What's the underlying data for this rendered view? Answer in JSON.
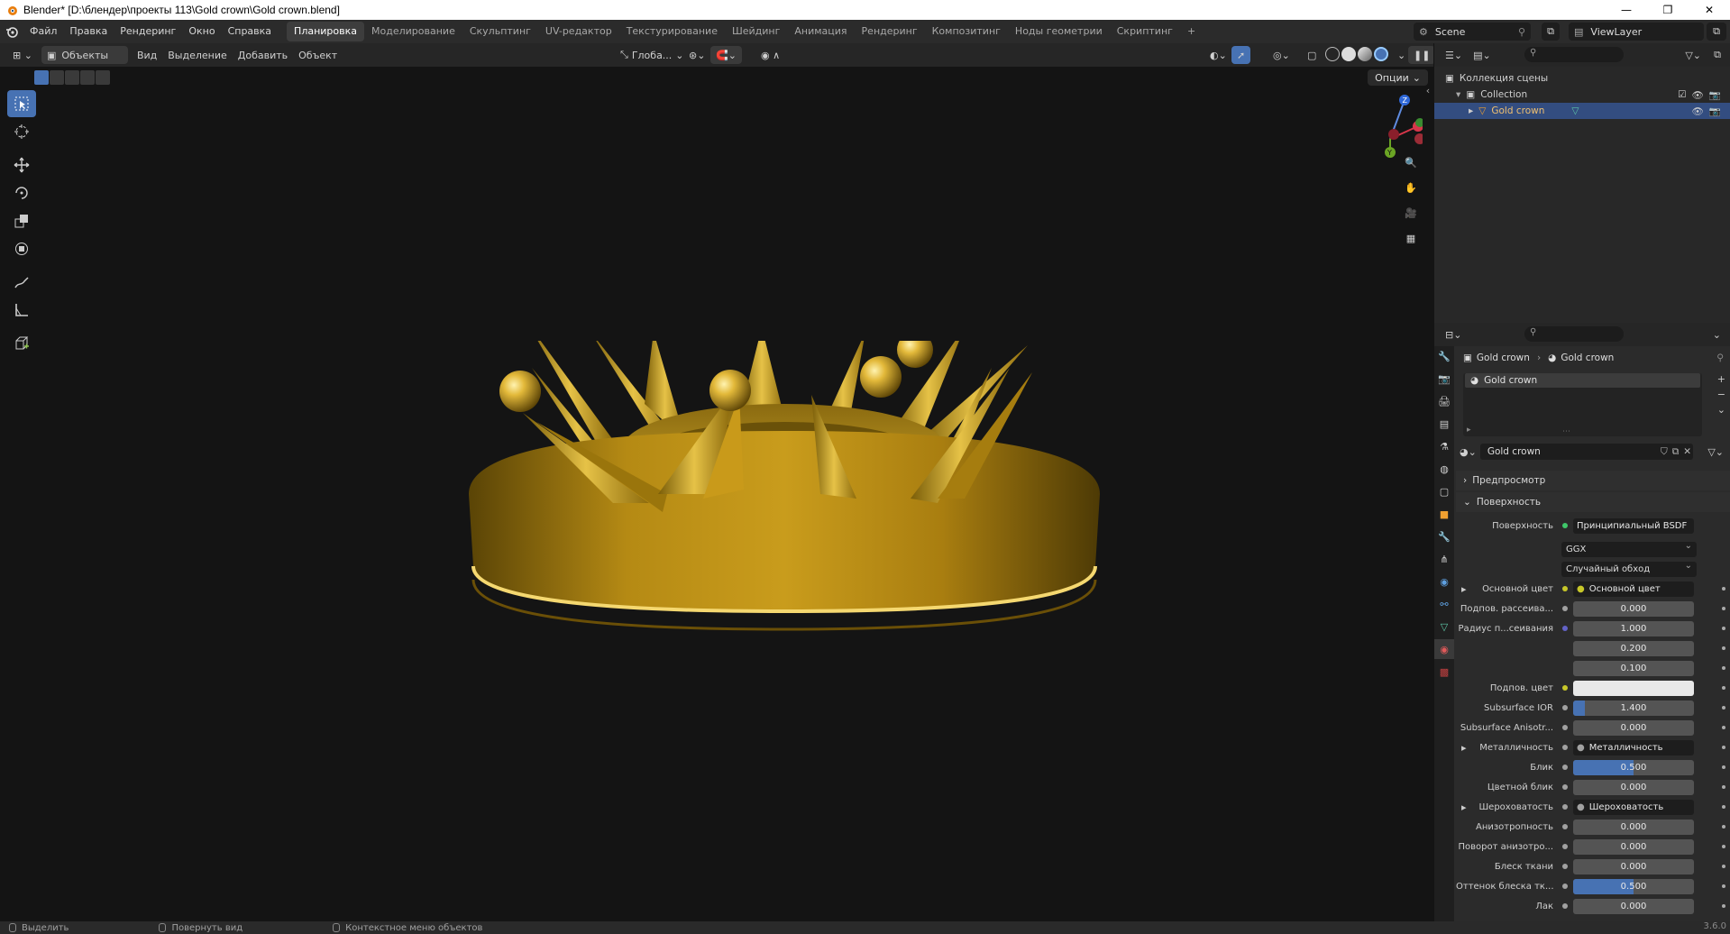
{
  "window": {
    "title": "Blender* [D:\\блендер\\проекты 113\\Gold crown\\Gold crown.blend]",
    "controls": [
      "—",
      "❐",
      "✕"
    ]
  },
  "menu": [
    "Файл",
    "Правка",
    "Рендеринг",
    "Окно",
    "Справка"
  ],
  "workspaces": [
    {
      "label": "Планировка",
      "active": true
    },
    {
      "label": "Моделирование"
    },
    {
      "label": "Скульптинг"
    },
    {
      "label": "UV-редактор"
    },
    {
      "label": "Текстурирование"
    },
    {
      "label": "Шейдинг"
    },
    {
      "label": "Анимация"
    },
    {
      "label": "Рендеринг"
    },
    {
      "label": "Композитинг"
    },
    {
      "label": "Ноды геометрии"
    },
    {
      "label": "Скриптинг"
    },
    {
      "label": "+"
    }
  ],
  "scene": {
    "name": "Scene",
    "view_layer": "ViewLayer"
  },
  "viewport": {
    "mode": "Объекты",
    "menus": [
      "Вид",
      "Выделение",
      "Добавить",
      "Объект"
    ],
    "transform_orientation": "Глоба...",
    "options": "Опции"
  },
  "outliner": {
    "rows": [
      {
        "label": "Коллекция сцены",
        "indent": 0
      },
      {
        "label": "Collection",
        "indent": 1
      },
      {
        "label": "Gold crown",
        "indent": 2,
        "selected": true
      }
    ]
  },
  "properties": {
    "breadcrumb": [
      "Gold crown",
      "Gold crown"
    ],
    "slot": "Gold crown",
    "material_name": "Gold crown",
    "panels": {
      "preview": "Предпросмотр",
      "surface": "Поверхность"
    },
    "surface_label": "Поверхность",
    "surface_value": "Принципиальный BSDF",
    "distribution": "GGX",
    "subsurface_method": "Случайный обход",
    "rows": [
      {
        "label": "Основной цвет",
        "value": "Основной цвет",
        "kind": "link",
        "sock": "#c7c729",
        "expand": true
      },
      {
        "label": "Подпов. рассеива...",
        "value": "0.000",
        "kind": "num",
        "sock": "#a1a1a1",
        "fill": 0
      },
      {
        "label": "Радиус п...сеивания",
        "value": "1.000",
        "kind": "num",
        "sock": "#6363c7",
        "fill": 0
      },
      {
        "label": "",
        "value": "0.200",
        "kind": "num",
        "sock": "",
        "fill": 0
      },
      {
        "label": "",
        "value": "0.100",
        "kind": "num",
        "sock": "",
        "fill": 0
      },
      {
        "label": "Подпов. цвет",
        "value": "",
        "kind": "color",
        "sock": "#c7c729",
        "fill": 0
      },
      {
        "label": "Subsurface IOR",
        "value": "1.400",
        "kind": "num",
        "sock": "#a1a1a1",
        "fill": 0.1
      },
      {
        "label": "Subsurface Anisotr...",
        "value": "0.000",
        "kind": "num",
        "sock": "#a1a1a1",
        "fill": 0
      },
      {
        "label": "Металличность",
        "value": "Металличность",
        "kind": "link",
        "sock": "#a1a1a1",
        "expand": true
      },
      {
        "label": "Блик",
        "value": "0.500",
        "kind": "num",
        "sock": "#a1a1a1",
        "fill": 0.5
      },
      {
        "label": "Цветной блик",
        "value": "0.000",
        "kind": "num",
        "sock": "#a1a1a1",
        "fill": 0
      },
      {
        "label": "Шероховатость",
        "value": "Шероховатость",
        "kind": "link",
        "sock": "#a1a1a1",
        "expand": true
      },
      {
        "label": "Анизотропность",
        "value": "0.000",
        "kind": "num",
        "sock": "#a1a1a1",
        "fill": 0
      },
      {
        "label": "Поворот анизотро...",
        "value": "0.000",
        "kind": "num",
        "sock": "#a1a1a1",
        "fill": 0
      },
      {
        "label": "Блеск ткани",
        "value": "0.000",
        "kind": "num",
        "sock": "#a1a1a1",
        "fill": 0
      },
      {
        "label": "Оттенок блеска тк...",
        "value": "0.500",
        "kind": "num",
        "sock": "#a1a1a1",
        "fill": 0.5
      },
      {
        "label": "Лак",
        "value": "0.000",
        "kind": "num",
        "sock": "#a1a1a1",
        "fill": 0
      }
    ]
  },
  "statusbar": {
    "items": [
      "Выделить",
      "Повернуть вид",
      "Контекстное меню объектов"
    ],
    "version": "3.6.0"
  },
  "colors": {
    "accent": "#4772b3",
    "selected_row": "#334d80",
    "gold": "#c9a227"
  }
}
